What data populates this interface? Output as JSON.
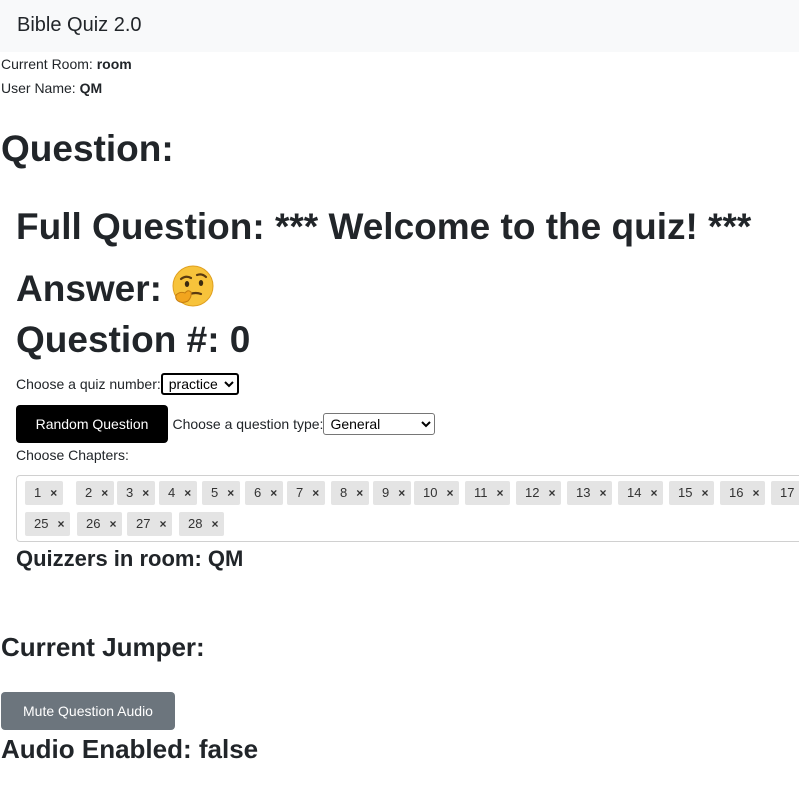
{
  "app": {
    "title": "Bible Quiz 2.0"
  },
  "meta": {
    "room_label": "Current Room:",
    "room_value": "room",
    "user_label": "User Name:",
    "user_value": "QM"
  },
  "question": {
    "heading": "Question:",
    "full_question": "Full Question: *** Welcome to the quiz! ***",
    "answer_label": "Answer:",
    "answer_icon": "thinking-face-icon",
    "number": "Question #: 0"
  },
  "controls": {
    "quiz_label": "Choose a quiz number:",
    "quiz_selected": "practice",
    "random_button": "Random Question",
    "type_label": "Choose a question type:",
    "type_selected": "General",
    "chapters_label": "Choose Chapters:"
  },
  "chapters": [
    "1",
    "2",
    "3",
    "4",
    "5",
    "6",
    "7",
    "8",
    "9",
    "10",
    "11",
    "12",
    "13",
    "14",
    "15",
    "16",
    "17",
    "25",
    "26",
    "27",
    "28"
  ],
  "room": {
    "quizzers": "Quizzers in room: QM",
    "jumper": "Current Jumper:",
    "mute_button": "Mute Question Audio",
    "audio_status": "Audio Enabled: false"
  },
  "colors": {
    "navbar_bg": "#f8f9fa",
    "primary_button": "#000000",
    "secondary_button": "#6c757d",
    "chip_bg": "#e4e4e4"
  }
}
